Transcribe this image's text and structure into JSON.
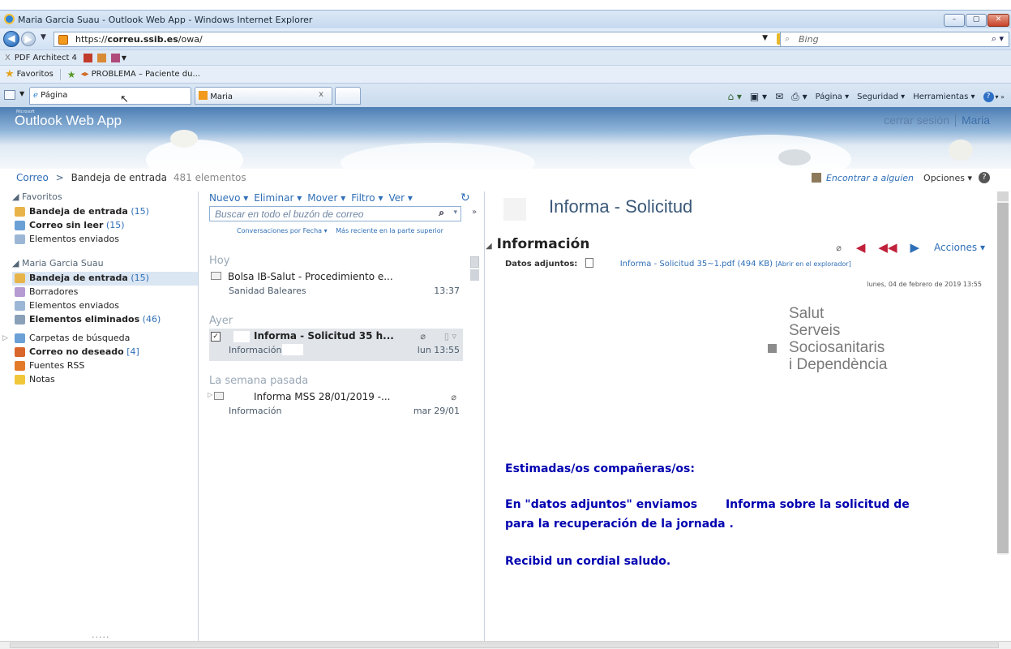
{
  "window": {
    "title": "Maria Garcia Suau - Outlook Web App - Windows Internet Explorer",
    "min_label": "–",
    "max_label": "▢",
    "close_label": "✕"
  },
  "address": {
    "url_prefix": "https://",
    "url_host": "correu.ssib.es",
    "url_path": "/owa/",
    "search_placeholder": "Bing"
  },
  "pdfbar": {
    "close": "X",
    "label": "PDF Architect 4"
  },
  "favorites": {
    "label": "Favoritos",
    "item": "PROBLEMA – Paciente du..."
  },
  "tabs": {
    "tab1_label": "Página",
    "tab2_label": "Maria",
    "tab2_close": "x"
  },
  "commandbar": {
    "pagina": "Página ▾",
    "seguridad": "Seguridad ▾",
    "herramientas": "Herramientas ▾"
  },
  "owa": {
    "brand_small": "Microsoft",
    "brand": "Outlook Web App",
    "signout": "cerrar sesión",
    "user": "Maria",
    "breadcrumb_root": "Correo",
    "breadcrumb_sep": ">",
    "breadcrumb_folder": "Bandeja de entrada",
    "breadcrumb_count": "481 elementos",
    "find_someone": "Encontrar a alguien",
    "options": "Opciones ▾"
  },
  "nav": {
    "favorites_header": "Favoritos",
    "fav_items": [
      {
        "label": "Bandeja de entrada",
        "count": "(15)"
      },
      {
        "label": "Correo sin leer",
        "count": "(15)"
      },
      {
        "label": "Elementos enviados",
        "count": ""
      }
    ],
    "account_header": "Maria Garcia Suau",
    "account_items": [
      {
        "label": "Bandeja de entrada",
        "count": "(15)"
      },
      {
        "label": "Borradores",
        "count": ""
      },
      {
        "label": "Elementos enviados",
        "count": ""
      },
      {
        "label": "Elementos eliminados",
        "count": "(46)"
      }
    ],
    "other_items": [
      {
        "label": "Carpetas de búsqueda",
        "count": ""
      },
      {
        "label": "Correo no deseado",
        "count": "[4]"
      },
      {
        "label": "Fuentes RSS",
        "count": ""
      },
      {
        "label": "Notas",
        "count": ""
      }
    ],
    "dots": "....."
  },
  "toolbar": {
    "nuevo": "Nuevo ▾",
    "eliminar": "Eliminar ▾",
    "mover": "Mover ▾",
    "filtro": "Filtro ▾",
    "ver": "Ver ▾"
  },
  "list": {
    "search_placeholder": "Buscar en todo el buzón de correo",
    "sort_by": "Conversaciones por Fecha ▾",
    "sort_order": "Más reciente en la parte superior",
    "groups": [
      "Hoy",
      "Ayer",
      "La semana pasada"
    ],
    "messages": [
      {
        "from": "Bolsa IB-Salut - Procedimiento e...",
        "subject": "Sanidad Baleares",
        "date": "13:37"
      },
      {
        "from": "Informa - Solicitud 35 h...",
        "subject": "Información",
        "date": "lun 13:55"
      },
      {
        "from": "Informa MSS 28/01/2019 -...",
        "subject": "Información",
        "date": "mar 29/01"
      }
    ]
  },
  "reading": {
    "title": "Informa - Solicitud",
    "section": "Información",
    "acciones": "Acciones ▾",
    "attach_label": "Datos adjuntos:",
    "attach_file": "Informa - Solicitud 35~1.pdf (494 KB)",
    "attach_open": "[Abrir en el explorador]",
    "date": "lunes, 04 de febrero de 2019 13:55",
    "logo_lines": [
      "Salut",
      "Serveis",
      "Sociosanitaris",
      "i Dependència"
    ],
    "body_greeting": "Estimadas/os compañeras/os:",
    "body_line1a": "En \"datos adjuntos\" enviamos",
    "body_line1b": "Informa sobre la solicitud de",
    "body_line2": "para la recuperación de la jornada .",
    "body_closing": "Recibid un cordial saludo."
  },
  "colors": {
    "accent": "#2f6fb7",
    "body_text": "#0000b0",
    "reply": "#c0203a"
  }
}
